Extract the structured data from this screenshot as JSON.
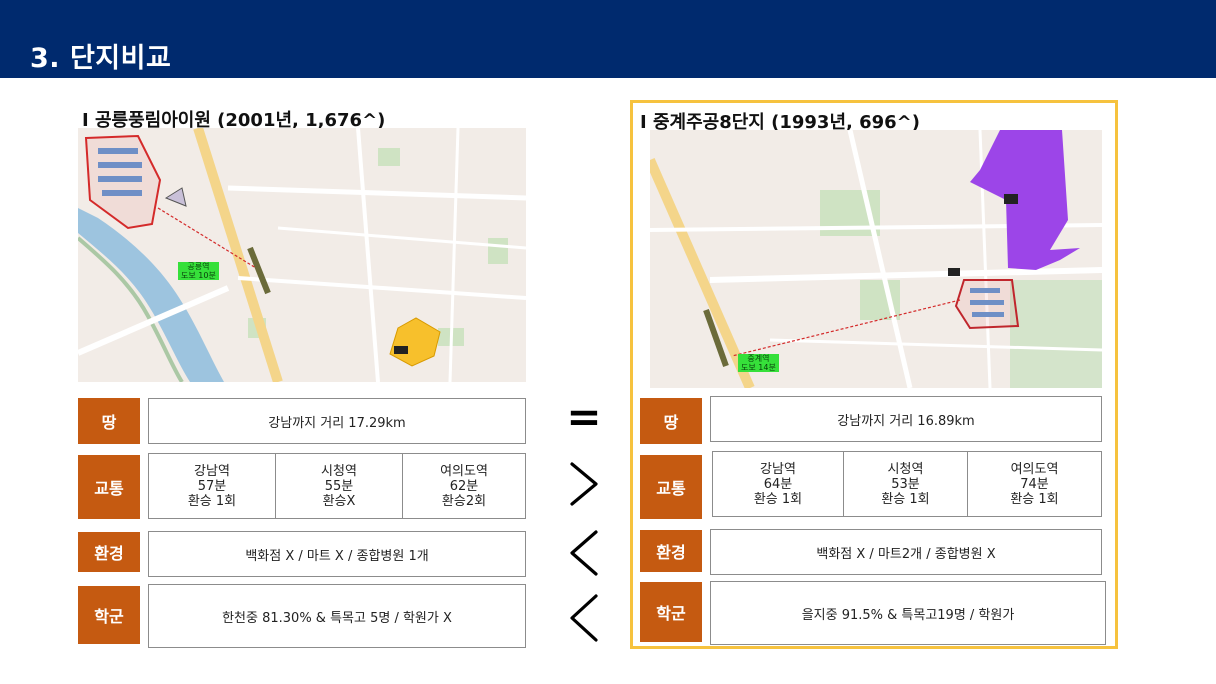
{
  "header": {
    "title": "3. 단지비교"
  },
  "left": {
    "title": "I 공릉풍림아이원 (2001년, 1,676^)",
    "map_station_label": "공릉역",
    "map_walk_label": "도보 10분",
    "land": "강남까지 거리 17.29km",
    "transit": [
      {
        "station": "강남역",
        "time": "57분",
        "transfer": "환승 1회"
      },
      {
        "station": "시청역",
        "time": "55분",
        "transfer": "환승X"
      },
      {
        "station": "여의도역",
        "time": "62분",
        "transfer": "환승2회"
      }
    ],
    "environment": "백화점 X / 마트 X / 종합병원 1개",
    "school": "한천중 81.30% & 특목고 5명 / 학원가 X"
  },
  "right": {
    "title": "I 중계주공8단지 (1993년, 696^)",
    "map_station_label": "중계역",
    "map_walk_label": "도보 14분",
    "land": "강남까지 거리 16.89km",
    "transit": [
      {
        "station": "강남역",
        "time": "64분",
        "transfer": "환승 1회"
      },
      {
        "station": "시청역",
        "time": "53분",
        "transfer": "환승 1회"
      },
      {
        "station": "여의도역",
        "time": "74분",
        "transfer": "환승 1회"
      }
    ],
    "environment": "백화점 X / 마트2개 / 종합병원 X",
    "school": "을지중 91.5% & 특목고19명 / 학원가"
  },
  "categories": {
    "land": "땅",
    "transit": "교통",
    "environment": "환경",
    "school": "학군"
  },
  "comparison": {
    "land": "=",
    "transit": ">",
    "environment": "<",
    "school": "<"
  },
  "colors": {
    "header_bg": "#002a6e",
    "category_bg": "#c55a11",
    "highlight_border": "#f6c23e"
  }
}
